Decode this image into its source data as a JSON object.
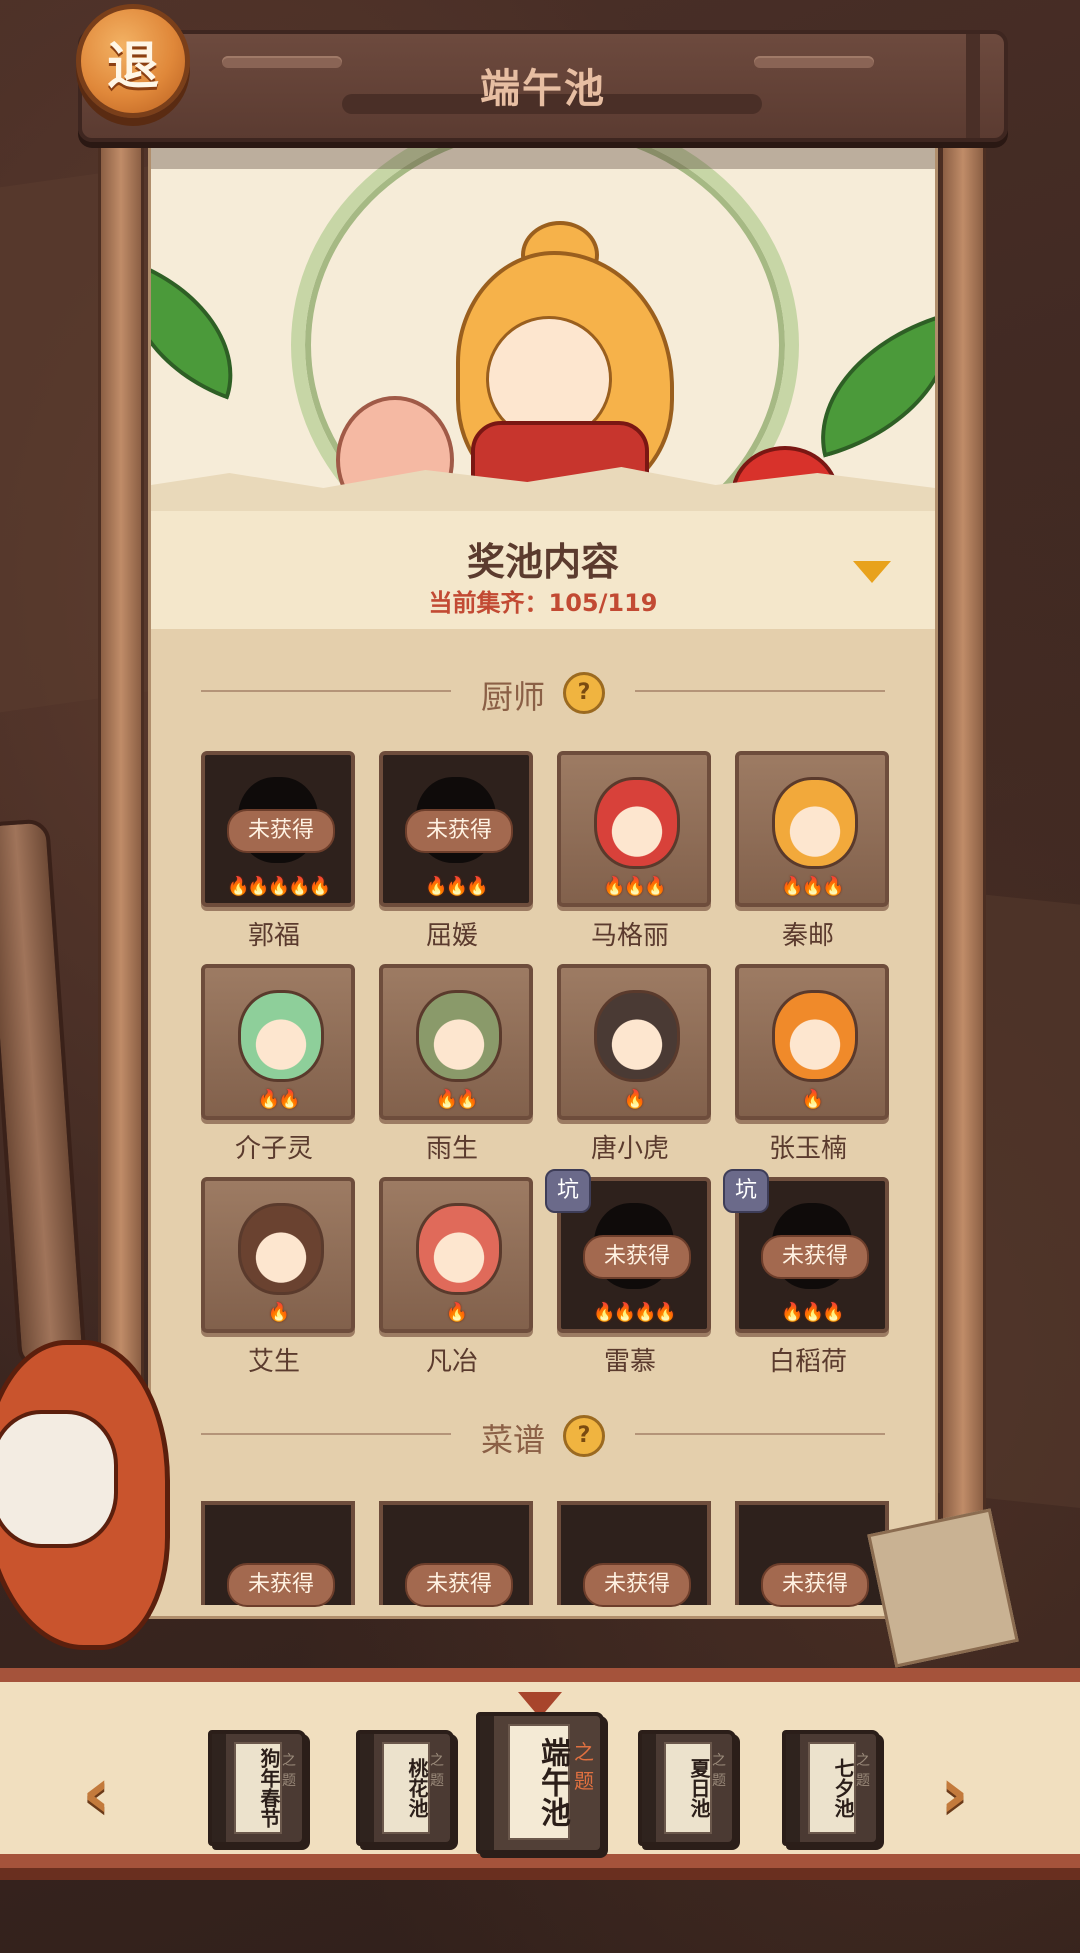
{
  "header": {
    "title": "端午池",
    "back_label": "退"
  },
  "banner": {},
  "pool": {
    "title": "奖池内容",
    "progress_label": "当前集齐：",
    "progress_value": "105/119"
  },
  "sections": {
    "chefs": {
      "label": "厨师",
      "help_icon": "?"
    },
    "recipes": {
      "label": "菜谱",
      "help_icon": "?"
    }
  },
  "chefs": [
    {
      "name": "郭福",
      "status": "未获得",
      "flames": "🔥🔥🔥🔥🔥",
      "obtained": false,
      "pit": ""
    },
    {
      "name": "屈媛",
      "status": "未获得",
      "flames": "🔥🔥🔥",
      "obtained": false,
      "pit": ""
    },
    {
      "name": "马格丽",
      "status": "",
      "flames": "🔥🔥🔥",
      "obtained": true,
      "pit": "",
      "color": "#d8413a"
    },
    {
      "name": "秦邮",
      "status": "",
      "flames": "🔥🔥🔥",
      "obtained": true,
      "pit": "",
      "color": "#f2a93b"
    },
    {
      "name": "介子灵",
      "status": "",
      "flames": "🔥🔥",
      "obtained": true,
      "pit": "",
      "color": "#8ecf9a"
    },
    {
      "name": "雨生",
      "status": "",
      "flames": "🔥🔥",
      "obtained": true,
      "pit": "",
      "color": "#8a9a6a"
    },
    {
      "name": "唐小虎",
      "status": "",
      "flames": "🔥",
      "obtained": true,
      "pit": "",
      "color": "#4a3a34"
    },
    {
      "name": "张玉楠",
      "status": "",
      "flames": "🔥",
      "obtained": true,
      "pit": "",
      "color": "#f08a2a"
    },
    {
      "name": "艾生",
      "status": "",
      "flames": "🔥",
      "obtained": true,
      "pit": "",
      "color": "#6a4230"
    },
    {
      "name": "凡冶",
      "status": "",
      "flames": "🔥",
      "obtained": true,
      "pit": "",
      "color": "#e06a5a"
    },
    {
      "name": "雷慕",
      "status": "未获得",
      "flames": "🔥🔥🔥🔥",
      "obtained": false,
      "pit": "坑"
    },
    {
      "name": "白稻荷",
      "status": "未获得",
      "flames": "🔥🔥🔥",
      "obtained": false,
      "pit": "坑"
    }
  ],
  "recipes": [
    {
      "status": "未获得"
    },
    {
      "status": "未获得"
    },
    {
      "status": "未获得"
    },
    {
      "status": "未获得"
    }
  ],
  "pools": [
    {
      "name": "狗年春节",
      "active": false
    },
    {
      "name": "桃花池",
      "active": false
    },
    {
      "name": "端午池",
      "active": true
    },
    {
      "name": "夏日池",
      "active": false
    },
    {
      "name": "七夕池",
      "active": false
    }
  ],
  "book_mark": "之题"
}
